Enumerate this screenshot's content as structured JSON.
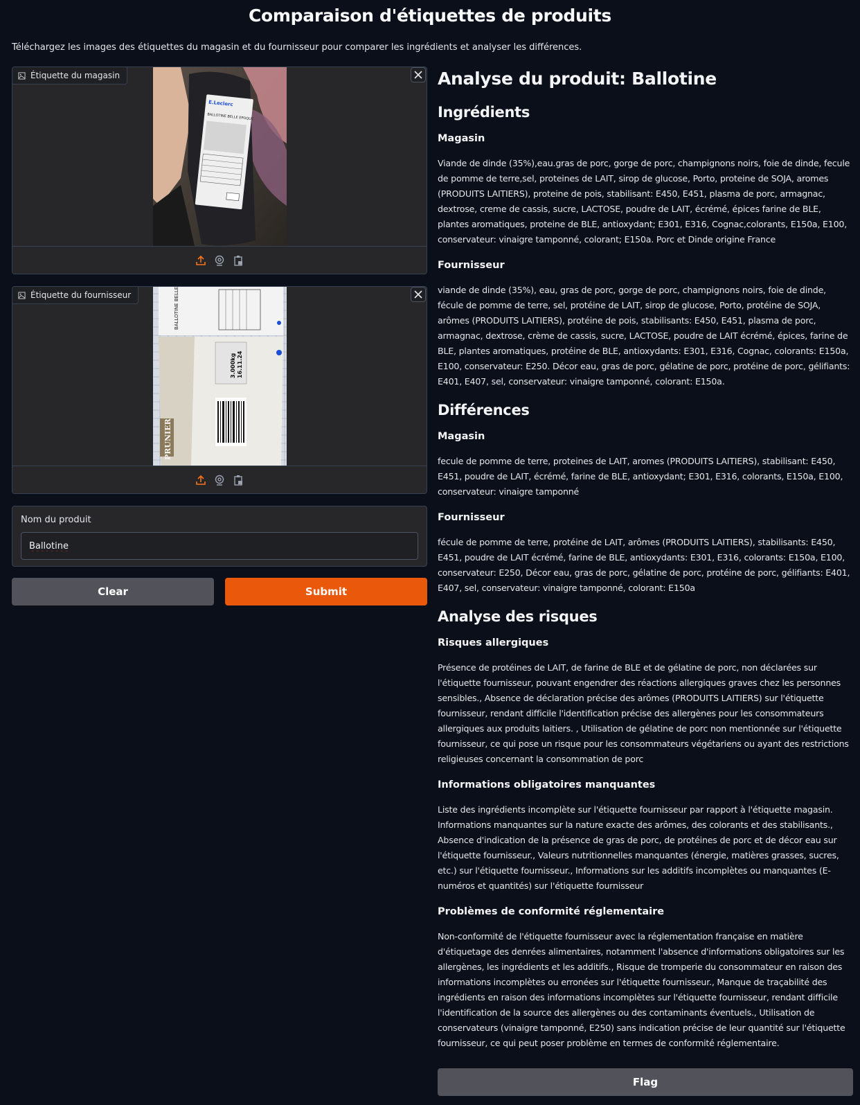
{
  "header": {
    "title": "Comparaison d'étiquettes de produits",
    "description": "Téléchargez les images des étiquettes du magasin et du fournisseur pour comparer les ingrédients et analyser les différences."
  },
  "store_image": {
    "label": "Étiquette du magasin",
    "label_icon": "image-icon",
    "photo_text": "BALLOTINE BELLE EPOQUE",
    "brand": "E.Leclerc"
  },
  "supplier_image": {
    "label": "Étiquette du fournisseur",
    "label_icon": "image-icon",
    "photo_text": "BALLOTINE BELLE EPOQUE",
    "brand": "PRUNIER"
  },
  "toolbar_icons": [
    "upload-icon",
    "webcam-icon",
    "clipboard-icon"
  ],
  "product": {
    "label": "Nom du produit",
    "value": "Ballotine"
  },
  "buttons": {
    "clear": "Clear",
    "submit": "Submit",
    "flag": "Flag"
  },
  "analysis": {
    "title": "Analyse du produit: Ballotine",
    "ingredients_heading": "Ingrédients",
    "ingredients_store_heading": "Magasin",
    "ingredients_store_text": "Viande de dinde (35%),eau.gras de porc, gorge de porc, champignons noirs, foie de dinde, fecule de pomme de terre,sel, proteines de LAIT, sirop de glucose, Porto, proteine de SOJA, aromes (PRODUITS LAITIERS), proteine de pois, stabilisant: E450, E451, plasma de porc, armagnac, dextrose, creme de cassis, sucre, LACTOSE, poudre de LAIT, écrémé, épices farine de BLE, plantes aromatiques, proteine de BLE, antioxydant; E301, E316, Cognac,colorants, E150a, E100, conservateur: vinaigre tamponné, colorant; E150a. Porc et Dinde origine France",
    "ingredients_supplier_heading": "Fournisseur",
    "ingredients_supplier_text": "viande de dinde (35%), eau, gras de porc, gorge de porc, champignons noirs, foie de dinde, fécule de pomme de terre, sel, protéine de LAIT, sirop de glucose, Porto, protéine de SOJA, arômes (PRODUITS LAITIERS), protéine de pois, stabilisants: E450, E451, plasma de porc, armagnac, dextrose, crème de cassis, sucre, LACTOSE, poudre de LAIT écrémé, épices, farine de BLE, plantes aromatiques, protéine de BLE, antioxydants: E301, E316, Cognac, colorants: E150a, E100, conservateur: E250. Décor eau, gras de porc, gélatine de porc, protéine de porc, gélifiants: E401, E407, sel, conservateur: vinaigre tamponné, colorant: E150a.",
    "differences_heading": "Différences",
    "differences_store_heading": "Magasin",
    "differences_store_text": "fecule de pomme de terre, proteines de LAIT, aromes (PRODUITS LAITIERS), stabilisant: E450, E451, poudre de LAIT, écrémé, farine de BLE, antioxydant; E301, E316, colorants, E150a, E100, conservateur: vinaigre tamponné",
    "differences_supplier_heading": "Fournisseur",
    "differences_supplier_text": "fécule de pomme de terre, protéine de LAIT, arômes (PRODUITS LAITIERS), stabilisants: E450, E451, poudre de LAIT écrémé, farine de BLE, antioxydants: E301, E316, colorants: E150a, E100, conservateur: E250, Décor eau, gras de porc, gélatine de porc, protéine de porc, gélifiants: E401, E407, sel, conservateur: vinaigre tamponné, colorant: E150a",
    "risks_heading": "Analyse des risques",
    "allergy_heading": "Risques allergiques",
    "allergy_text": "Présence de protéines de LAIT, de farine de BLE et de gélatine de porc, non déclarées sur l'étiquette fournisseur, pouvant engendrer des réactions allergiques graves chez les personnes sensibles., Absence de déclaration précise des arômes (PRODUITS LAITIERS) sur l'étiquette fournisseur, rendant difficile l'identification précise des allergènes pour les consommateurs allergiques aux produits laitiers. , Utilisation de gélatine de porc non mentionnée sur l'étiquette fournisseur, ce qui pose un risque pour les consommateurs végétariens ou ayant des restrictions religieuses concernant la consommation de porc",
    "missing_heading": "Informations obligatoires manquantes",
    "missing_text": "Liste des ingrédients incomplète sur l'étiquette fournisseur par rapport à l'étiquette magasin. Informations manquantes sur la nature exacte des arômes, des colorants et des stabilisants., Absence d'indication de la présence de gras de porc, de protéines de porc et de décor eau sur l'étiquette fournisseur., Valeurs nutritionnelles manquantes (énergie, matières grasses, sucres, etc.) sur l'étiquette fournisseur., Informations sur les additifs incomplètes ou manquantes (E-numéros et quantités) sur l'étiquette fournisseur",
    "compliance_heading": "Problèmes de conformité réglementaire",
    "compliance_text": "Non-conformité de l'étiquette fournisseur avec la réglementation française en matière d'étiquetage des denrées alimentaires, notamment l'absence d'informations obligatoires sur les allergènes, les ingrédients et les additifs., Risque de tromperie du consommateur en raison des informations incomplètes ou erronées sur l'étiquette fournisseur., Manque de traçabilité des ingrédients en raison des informations incomplètes sur l'étiquette fournisseur, rendant difficile l'identification de la source des allergènes ou des contaminants éventuels., Utilisation de conservateurs (vinaigre tamponné, E250) sans indication précise de leur quantité sur l'étiquette fournisseur, ce qui peut poser problème en termes de conformité réglementaire."
  }
}
